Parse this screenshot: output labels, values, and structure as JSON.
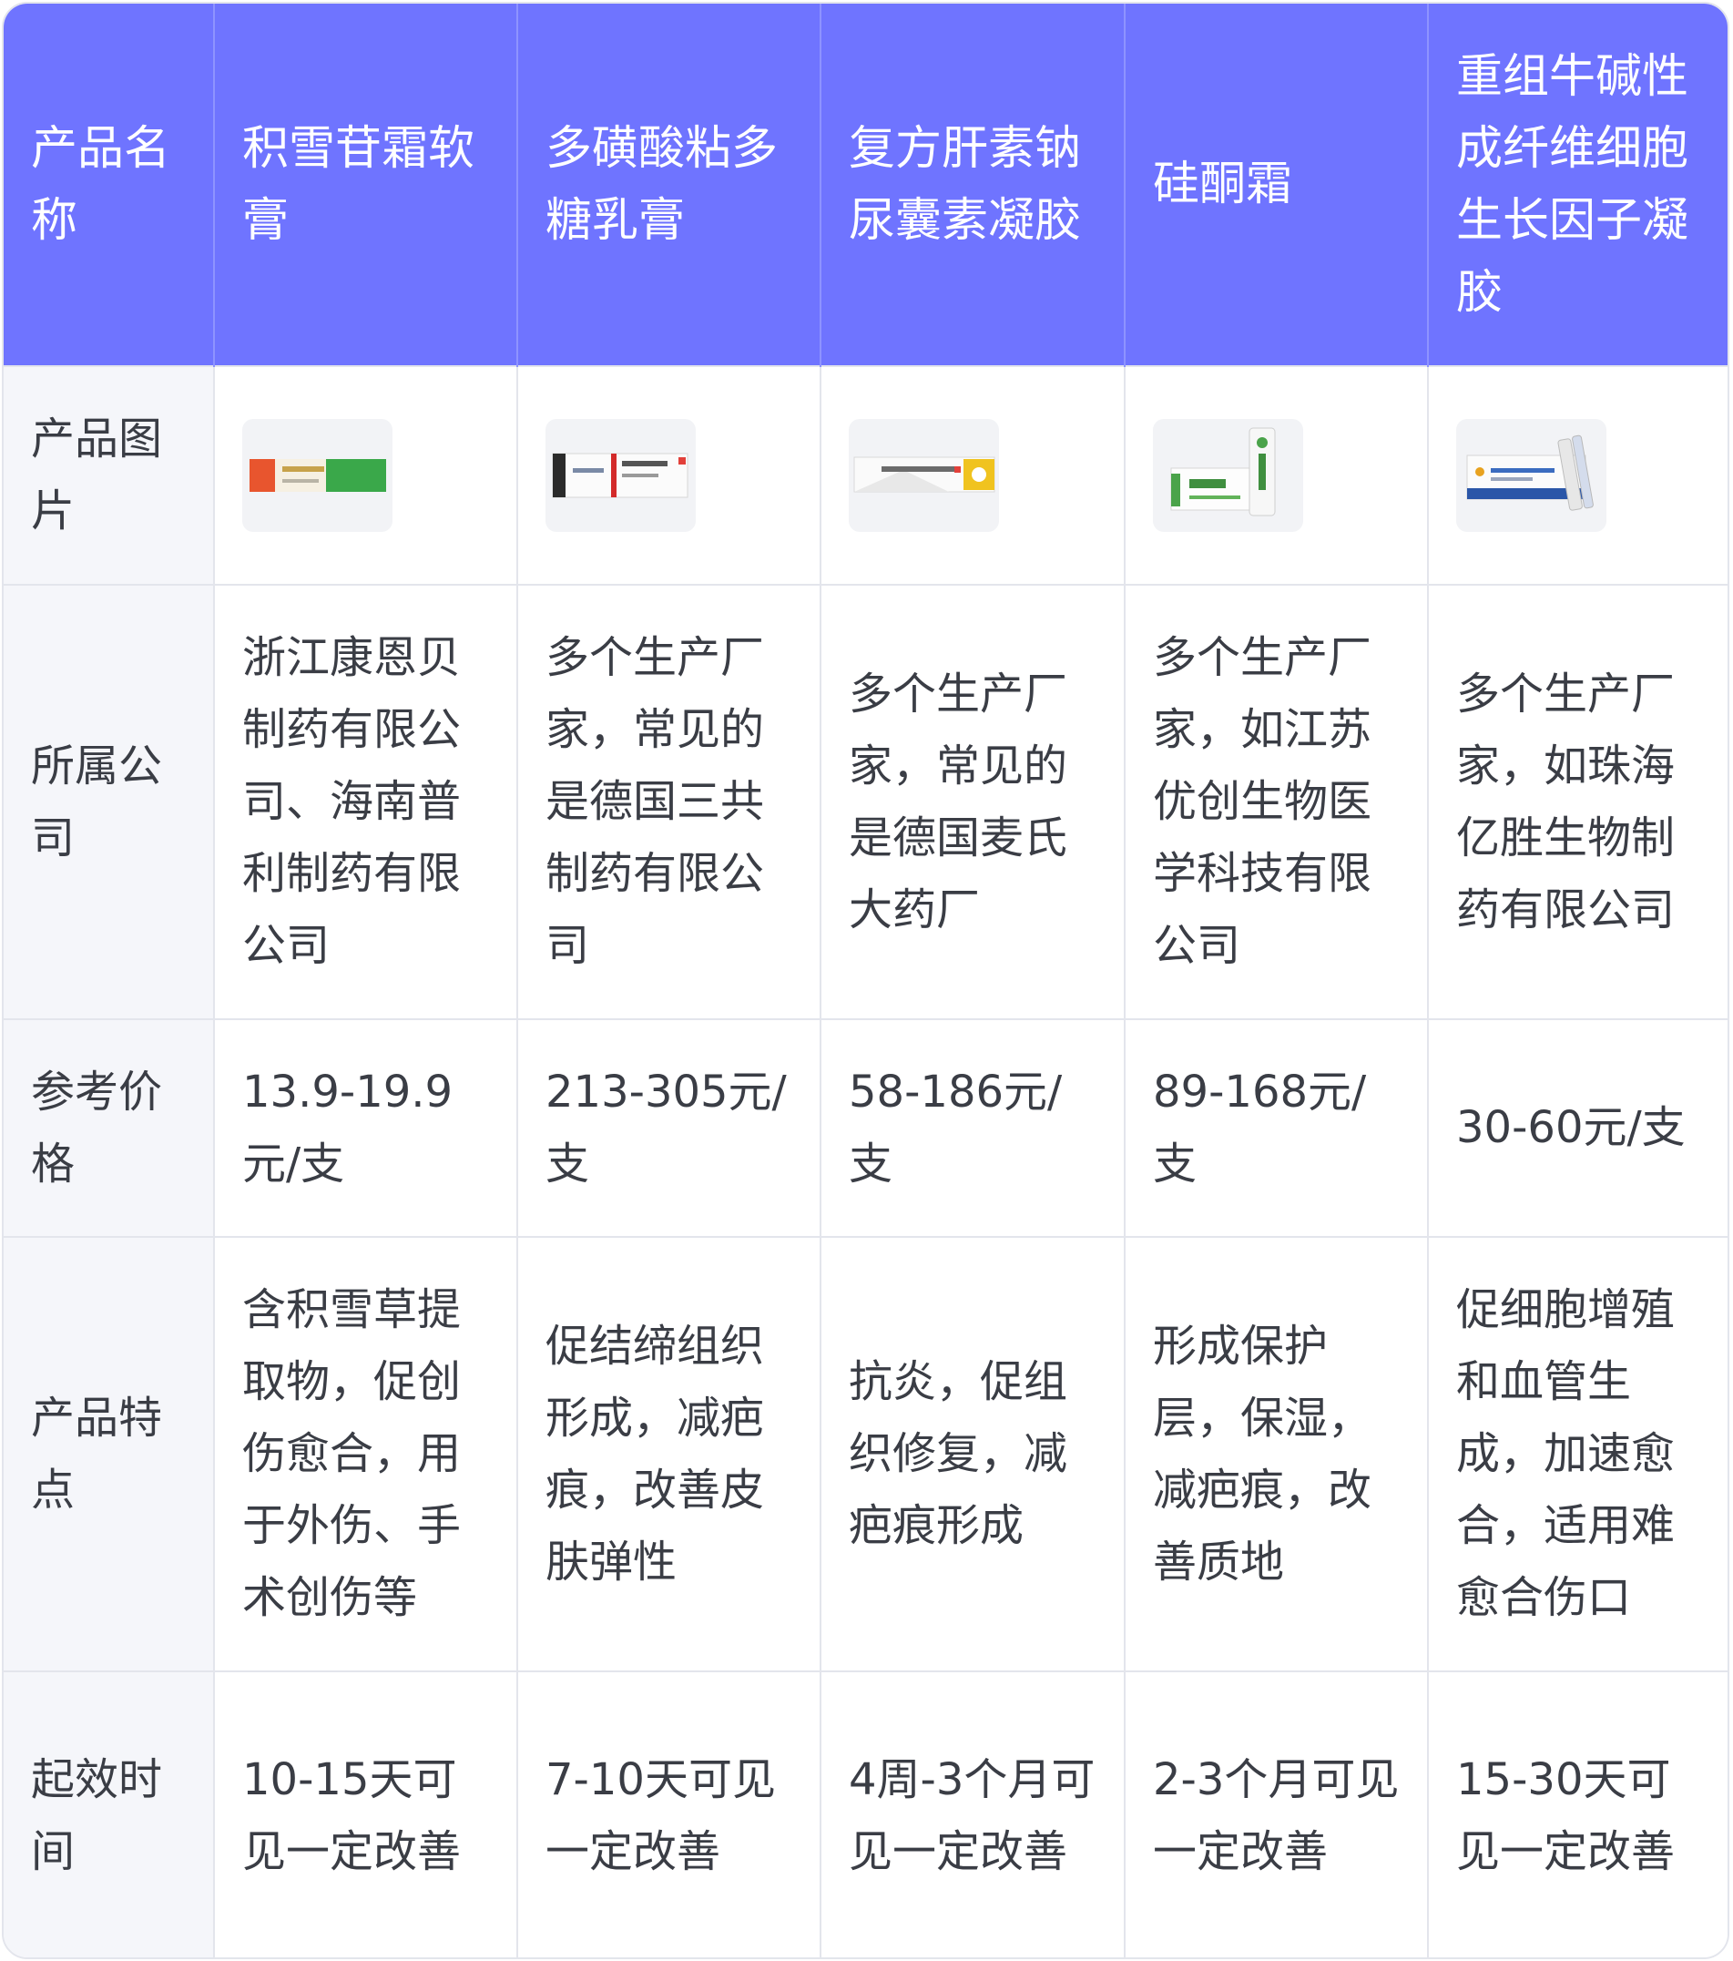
{
  "table": {
    "headers": [
      "产品名称",
      "积雪苷霜软膏",
      "多磺酸粘多糖乳膏",
      "复方肝素钠尿囊素凝胶",
      "硅酮霜",
      "重组牛碱性成纤维细胞生长因子凝胶"
    ],
    "rows": [
      {
        "label": "产品图片",
        "cells": [
          "",
          "",
          "",
          "",
          ""
        ]
      },
      {
        "label": "所属公司",
        "cells": [
          "浙江康恩贝制药有限公司、海南普利制药有限公司",
          "多个生产厂家，常见的是德国三共制药有限公司",
          "多个生产厂家，常见的是德国麦氏大药厂",
          "多个生产厂家，如江苏优创生物医学科技有限公司",
          "多个生产厂家，如珠海亿胜生物制药有限公司"
        ]
      },
      {
        "label": "参考价格",
        "cells": [
          "13.9-19.9元/支",
          "213-305元/支",
          "58-186元/支",
          "89-168元/支",
          "30-60元/支"
        ]
      },
      {
        "label": "产品特点",
        "cells": [
          "含积雪草提取物，促创伤愈合，用于外伤、手术创伤等",
          "促结缔组织形成，减疤痕，改善皮肤弹性",
          "抗炎，促组织修复，减疤痕形成",
          "形成保护层，保湿，减疤痕，改善质地",
          "促细胞增殖和血管生成，加速愈合，适用难愈合伤口"
        ]
      },
      {
        "label": "起效时间",
        "cells": [
          "10-15天可见一定改善",
          "7-10天可见一定改善",
          "4周-3个月可见一定改善",
          "2-3个月可见一定改善",
          "15-30天可见一定改善"
        ]
      }
    ]
  },
  "colors": {
    "header_bg": "#6f74ff",
    "header_text": "#ffffff",
    "label_bg": "#f5f6fa",
    "border": "#e3e5ec",
    "body_text": "#3a3d45"
  }
}
